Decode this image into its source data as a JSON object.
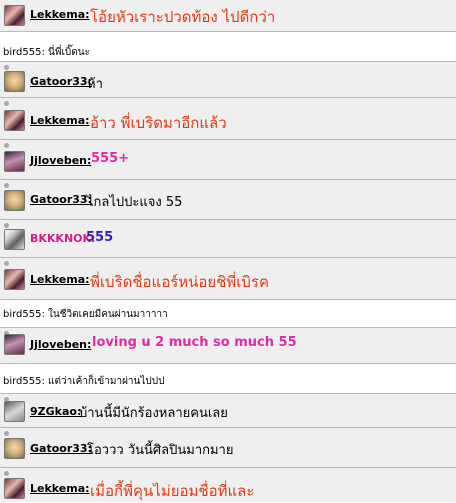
{
  "rows": [
    {
      "user": "Lekkema:",
      "message": "โอ้ยหัวเราะปวดท้อง ไปดีกว่า"
    },
    {
      "line": "bird555: นี่พี่เบิ๊ดนะ"
    },
    {
      "user": "Gatoor33:",
      "message": "ห้า"
    },
    {
      "user": "Lekkema:",
      "message": "อ้าว พี่เบริดมาอีกแล้ว"
    },
    {
      "user": "Jjloveben:",
      "message": "555+"
    },
    {
      "user": "Gatoor33:",
      "message": "ไกลไปปะแจง 55"
    },
    {
      "user": "BKKKNOK:",
      "message": "555"
    },
    {
      "user": "Lekkema:",
      "message": "พี่เบริดชื่อแอร์หน่อยชิพี่เบิรค"
    },
    {
      "line": "bird555: ในชีวิตเคยมีคนผ่านมาาาาา"
    },
    {
      "user": "Jjloveben:",
      "message": "loving u 2 much so much 55"
    },
    {
      "line": "bird555: แต่ว่าเค้าก็เข้ามาผ่านไปปป"
    },
    {
      "user": "9ZGkao:",
      "message": "บ้านนี้มีนักร้องหลายคนเลย"
    },
    {
      "user": "Gatoor33:",
      "message": "โอววว วันนี้ศิลปินมากมาย"
    },
    {
      "user": "Lekkema:",
      "message": "เมื่อกี้พี่คุนไม่ยอมชื่อที่และ"
    }
  ],
  "colors": {
    "lekkema": "#e23a15",
    "jjloveben": "#e02aa8",
    "bkkknok": "#3b1fb8",
    "row_bg": "#efefef",
    "border": "#b9b9b9"
  }
}
